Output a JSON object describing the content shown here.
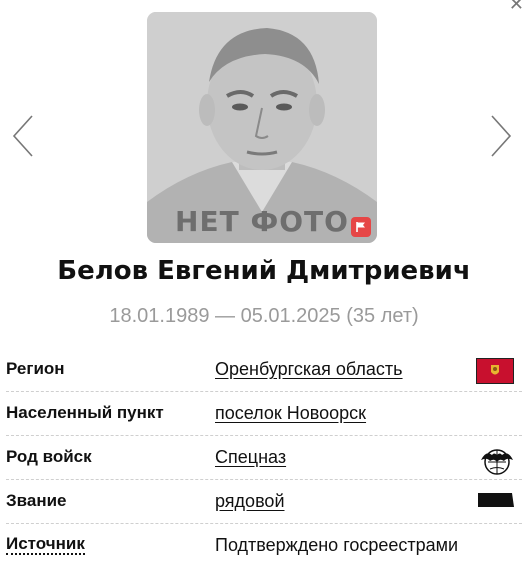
{
  "profile": {
    "photo_placeholder": "НЕТ ФОТО",
    "name": "Белов Евгений Дмитриевич",
    "dates": "18.01.1989 — 05.01.2025 (35 лет)"
  },
  "details": [
    {
      "label": "Регион",
      "value": "Оренбургская область",
      "icon": "region-flag-icon"
    },
    {
      "label": "Населенный пункт",
      "value": "поселок Новоорск",
      "icon": ""
    },
    {
      "label": "Род войск",
      "value": "Спецназ",
      "icon": "spetsnaz-emblem-icon"
    },
    {
      "label": "Звание",
      "value": "рядовой",
      "icon": "rank-insignia-icon"
    },
    {
      "label": "Источник",
      "value": "Подтверждено госреестрами",
      "icon": ""
    }
  ],
  "icons": {
    "close": "close-icon",
    "prev": "chevron-left-icon",
    "next": "chevron-right-icon",
    "report": "flag-icon"
  },
  "colors": {
    "report_button": "#e64646",
    "region_flag": "#c8102e",
    "placeholder_text": "#6e6e6e",
    "dates_text": "#9a9a9a"
  }
}
